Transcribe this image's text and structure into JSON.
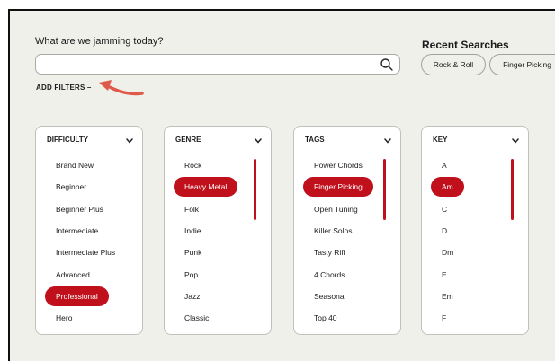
{
  "prompt": {
    "label": "What are we jamming today?",
    "search_value": "",
    "search_icon": "search-icon"
  },
  "add_filters": "ADD FILTERS –",
  "recent": {
    "title": "Recent Searches",
    "chips": [
      "Rock & Roll",
      "Finger Picking"
    ]
  },
  "accent_color": "#c0101c",
  "filters": [
    {
      "header": "DIFFICULTY",
      "items": [
        "Brand New",
        "Beginner",
        "Beginner Plus",
        "Intermediate",
        "Intermediate Plus",
        "Advanced",
        "Professional",
        "Hero"
      ],
      "selected": "Professional",
      "scrollable": false
    },
    {
      "header": "GENRE",
      "items": [
        "Rock",
        "Heavy Metal",
        "Folk",
        "Indie",
        "Punk",
        "Pop",
        "Jazz",
        "Classic"
      ],
      "selected": "Heavy Metal",
      "scrollable": true
    },
    {
      "header": "TAGS",
      "items": [
        "Power Chords",
        "Finger Picking",
        "Open Tuning",
        "Killer Solos",
        "Tasty Riff",
        "4 Chords",
        "Seasonal",
        "Top 40"
      ],
      "selected": "Finger Picking",
      "scrollable": true
    },
    {
      "header": "KEY",
      "items": [
        "A",
        "Am",
        "C",
        "D",
        "Dm",
        "E",
        "Em",
        "F"
      ],
      "selected": "Am",
      "scrollable": true
    }
  ]
}
